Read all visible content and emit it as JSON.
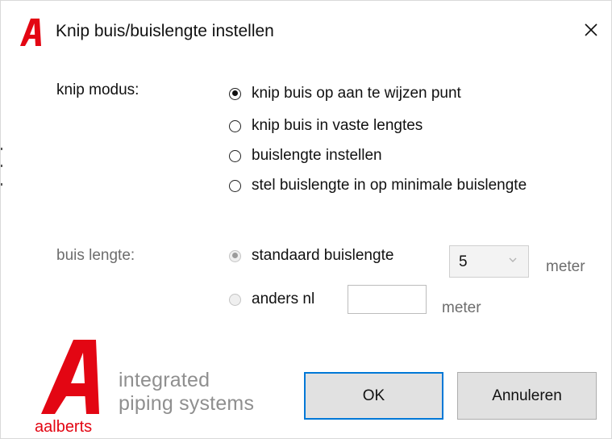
{
  "dialog": {
    "title": "Knip buis/buislengte instellen",
    "icons": {
      "title_logo": "aalberts-logo-icon",
      "close": "close-icon"
    }
  },
  "cut_mode": {
    "label": "knip modus:",
    "options": [
      {
        "label": "knip buis op aan te wijzen punt",
        "checked": true
      },
      {
        "label": "knip buis in vaste lengtes",
        "checked": false
      },
      {
        "label": "buislengte instellen",
        "checked": false
      },
      {
        "label": "stel buislengte in op minimale buislengte",
        "checked": false
      }
    ]
  },
  "pipe_length": {
    "label": "buis lengte:",
    "enabled": false,
    "standard": {
      "label": "standaard buislengte",
      "checked": true,
      "value": "5",
      "unit": "meter"
    },
    "other": {
      "label": "anders nl",
      "checked": false,
      "value": "",
      "unit": "meter"
    }
  },
  "branding": {
    "line1": "integrated",
    "line2": "piping systems",
    "logo_text": "aalberts",
    "color": "#e30613"
  },
  "buttons": {
    "ok": "OK",
    "cancel": "Annuleren"
  },
  "colors": {
    "accent": "#0078d7",
    "muted_text": "#6d6d6d",
    "button_face": "#e1e1e1"
  }
}
